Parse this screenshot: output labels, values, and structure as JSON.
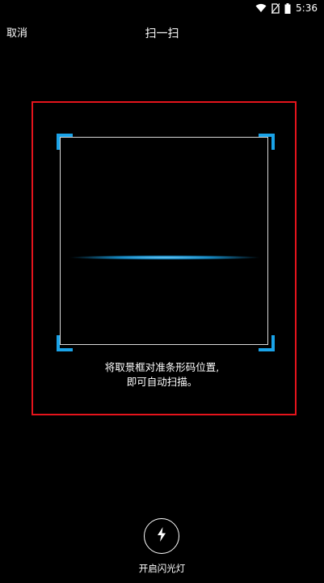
{
  "status_bar": {
    "time": "5:36",
    "icons": [
      "wifi-icon",
      "no-sim-icon",
      "battery-icon"
    ]
  },
  "toolbar": {
    "cancel_label": "取消",
    "title": "扫一扫"
  },
  "scanner": {
    "hint_line1": "将取景框对准条形码位置,",
    "hint_line2": "即可自动扫描。",
    "accent_color": "#1aa3e8",
    "highlight_color": "#e5141c"
  },
  "flashlight": {
    "icon": "lightning-bolt-icon",
    "label": "开启闪光灯"
  }
}
